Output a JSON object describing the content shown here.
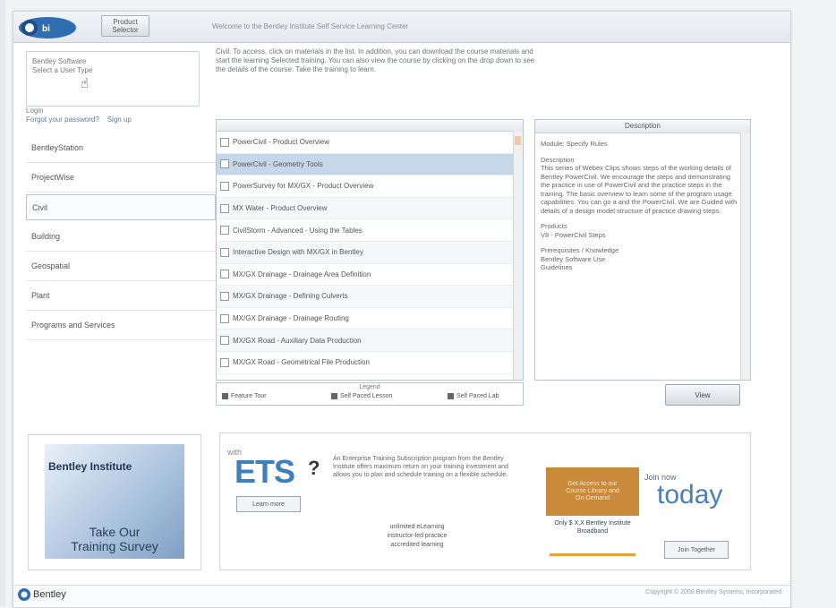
{
  "header": {
    "product_button": "Product Selector",
    "welcome": "Welcome to the Bentley Institute Self Service Learning Center"
  },
  "login": {
    "label": "Bentley Software",
    "username": "Select a User Type",
    "hint": "Login",
    "forgot": "Forgot your password?",
    "signup": "Sign up"
  },
  "nav": [
    {
      "label": "BentleyStation"
    },
    {
      "label": "ProjectWise"
    },
    {
      "label": "Civil"
    },
    {
      "label": "Building"
    },
    {
      "label": "Geospatial"
    },
    {
      "label": "Plant"
    },
    {
      "label": "Programs and Services"
    }
  ],
  "intro": "Civil. To access, click on materials in the list. In addition, you can download the course materials and start the learning Selected training. You can also view the course by clicking on the drop down to see the details of the course. Take the training to learn.",
  "courses": [
    "PowerCivil - Product Overview",
    "PowerCivil - Geometry Tools",
    "PowerSurvey for MX/GX - Product Overview",
    "MX Water - Product Overview",
    "CivilStorm - Advanced - Using the Tables",
    "Interactive Design with MX/GX in Bentley",
    "MX/GX Drainage - Drainage Area Definition",
    "MX/GX Drainage - Defining Culverts",
    "MX/GX Drainage - Drainage Routing",
    "MX/GX Road - Auxiliary Data Production",
    "MX/GX Road - Geometrical File Production"
  ],
  "legend": {
    "title": "Legend",
    "items": [
      "Feature Tour",
      "Self Paced Lesson",
      "Self Paced Lab"
    ]
  },
  "description": {
    "header": "Description",
    "title": "Module: Specify Rules",
    "heading": "Description",
    "body": "This series of Webex Clips shows steps of the working details of Bentley PowerCivil. We encourage the steps and demonstrating the practice in use of PowerCivil and the practice steps in the training. The basic overview to learn some of the program usage capabilities. You can go a and the PowerCivil. We are Guided with details of a design model structure of practice drawing steps.",
    "products_label": "Products",
    "products": "V8 - PowerCivil Steps",
    "prereq_label": "Prerequisites / Knowledge",
    "prereq": "Bentley Software Use",
    "prereq2": "Guidelines"
  },
  "view_button": "View",
  "promo_left": {
    "brand": "Bentley Institute",
    "survey_line1": "Take Our",
    "survey_line2": "Training Survey"
  },
  "promo_right": {
    "pre": "with",
    "ets": "ETS",
    "learn_button": "Learn more",
    "text": "An Enterprise Training Subscription program from the Bentley Institute offers maximum return on your training investment and allows you to plan and schedule training on a flexible schedule.",
    "bullets": [
      "unlimited eLearning",
      "instructor-led practice",
      "accredited learning"
    ],
    "orange_lines": [
      "Get Access to our",
      "Course Library and",
      "On-Demand"
    ],
    "orange_sub": "Only $ X,X Bentley Institute Broadband",
    "join_small": "Join now",
    "today": "today",
    "register_button": "Join Together"
  },
  "footer": {
    "logo": "Bentley",
    "copyright": "Copyright © 2008 Bentley Systems, Incorporated"
  },
  "colors": {
    "accent": "#3d7fbf",
    "highlight": "#c7d7ea",
    "orange": "#c98a3c"
  }
}
